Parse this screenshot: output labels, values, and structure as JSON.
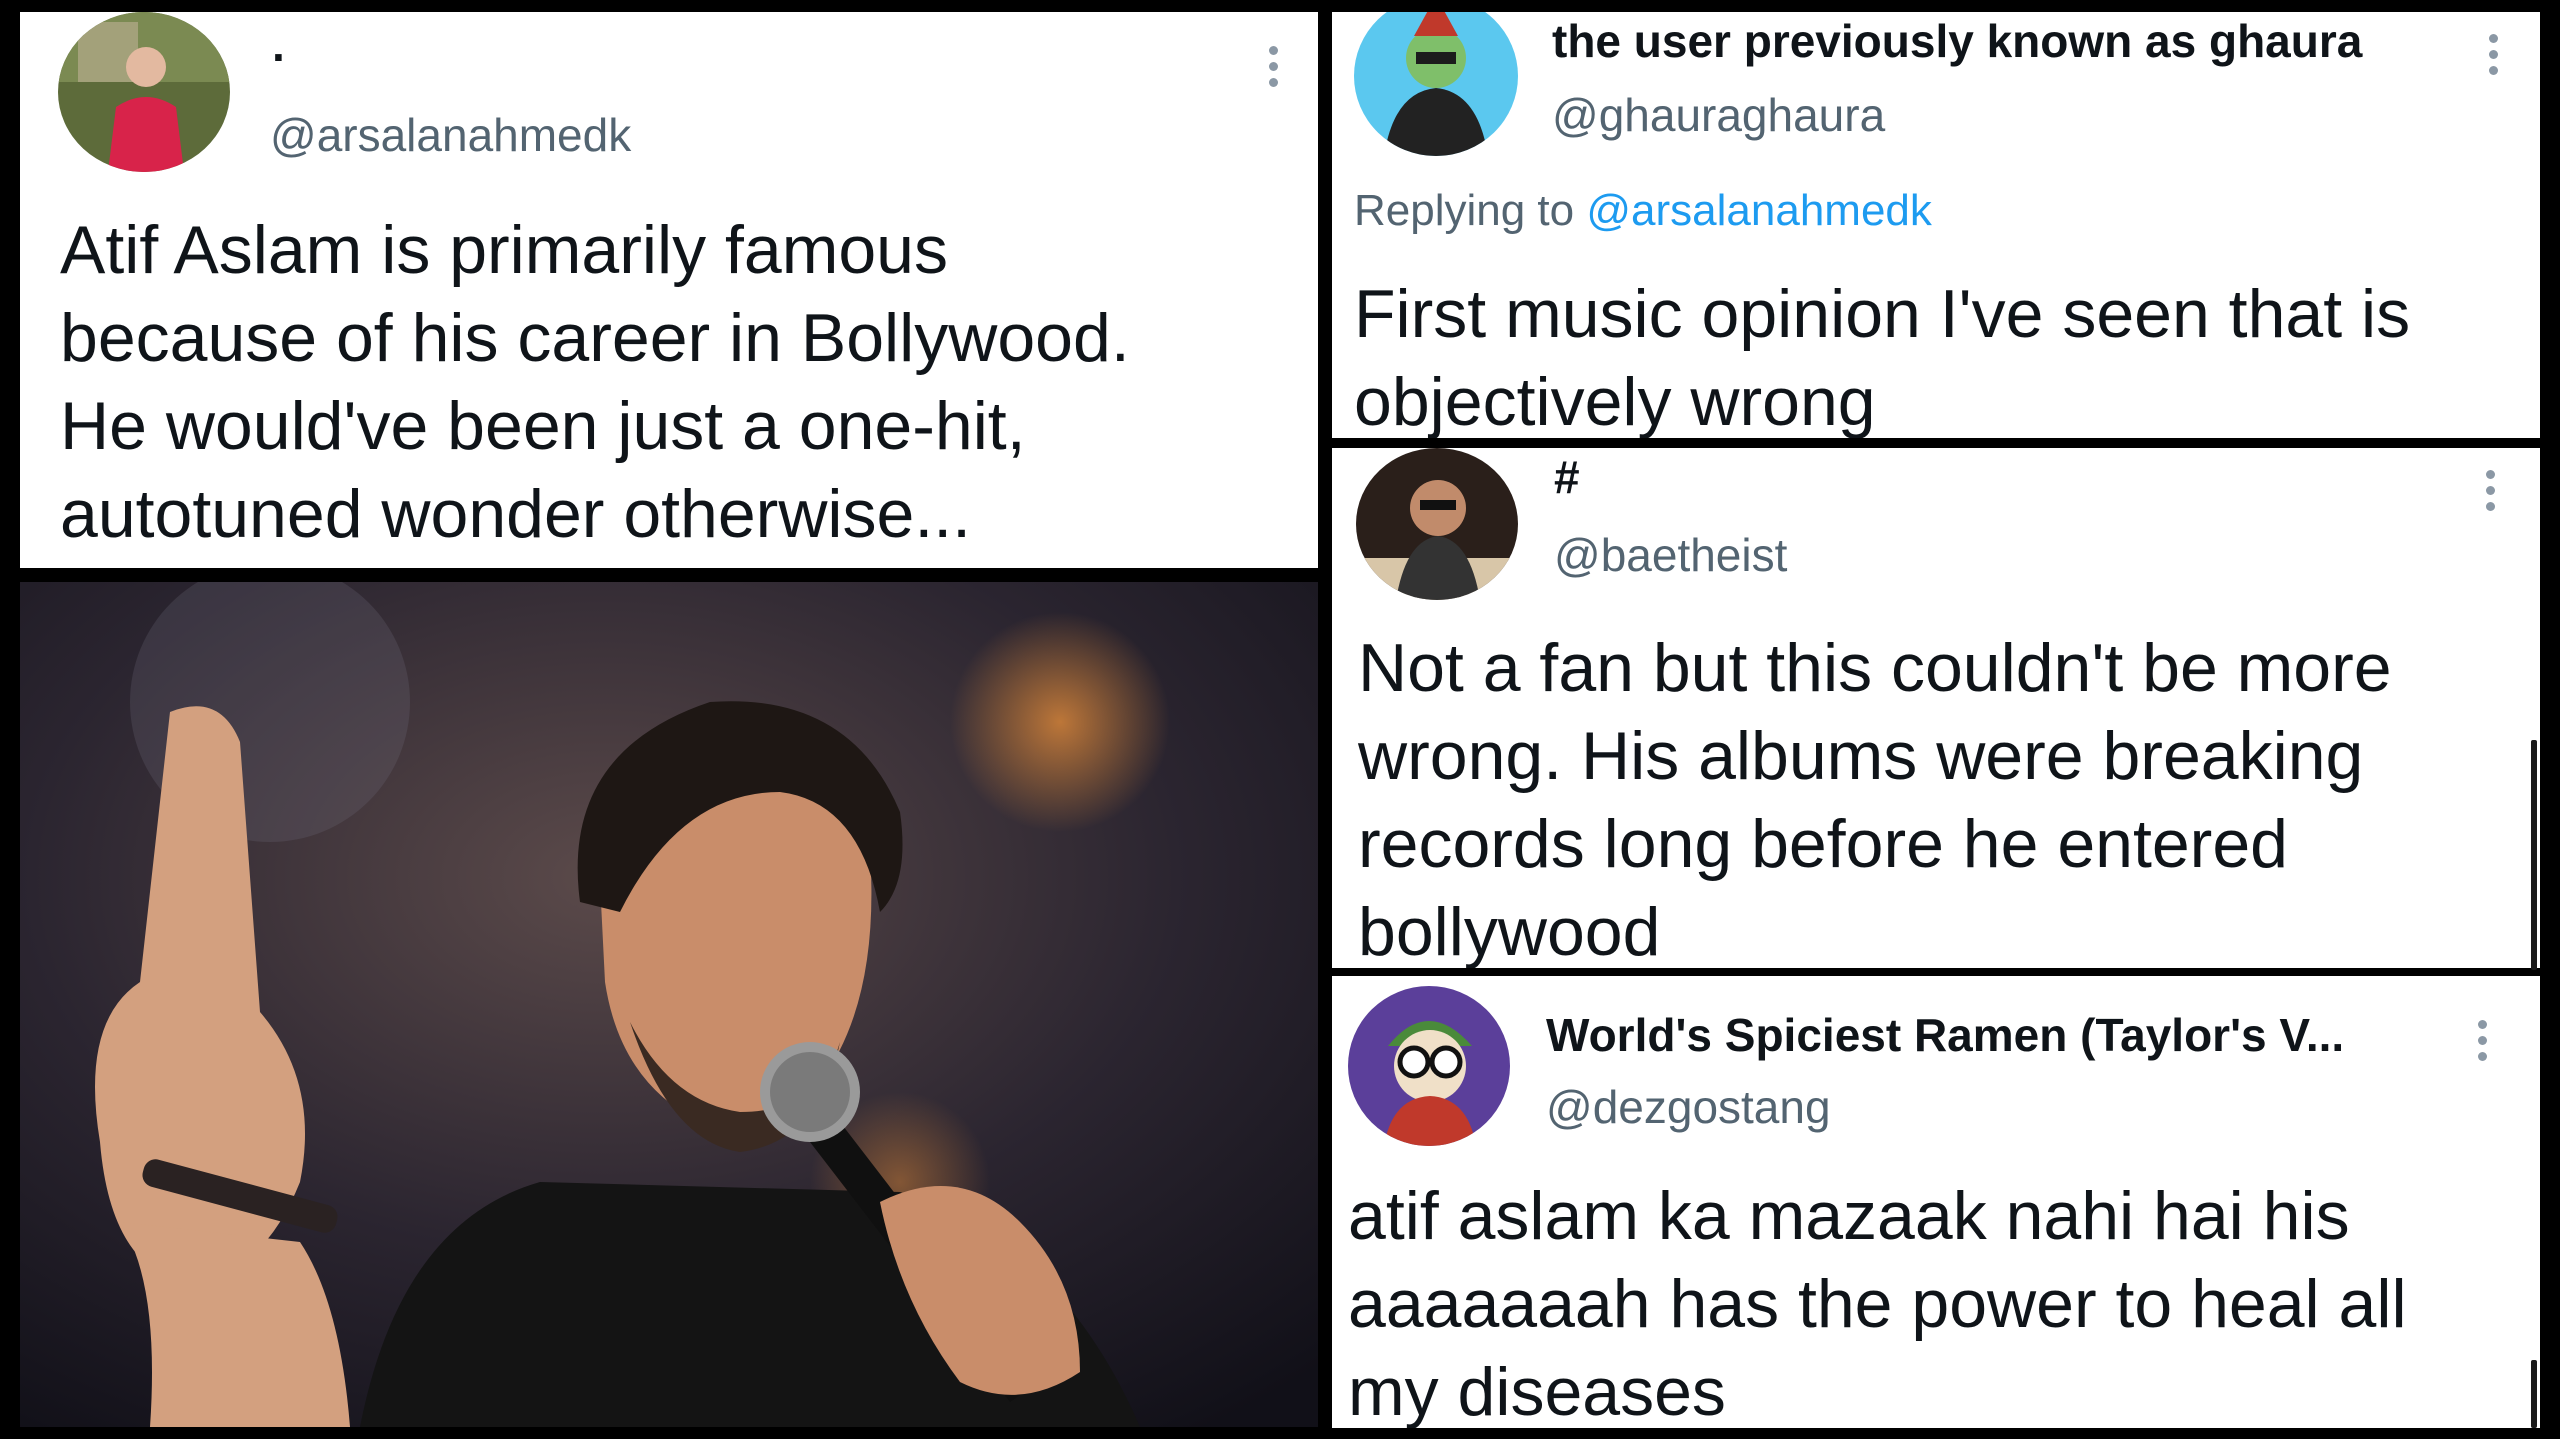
{
  "main_tweet": {
    "display_name": "·",
    "handle": "@arsalanahmedk",
    "text": "Atif Aslam is primarily famous\nbecause of his career in Bollywood.\nHe would've been just a one-hit,\nautotuned wonder otherwise...",
    "avatar_icon": "person-avatar-icon",
    "more_icon": "more-options-icon"
  },
  "reply_1": {
    "display_name": "the user previously known as ghaura",
    "handle": "@ghauraghaura",
    "replying_label": "Replying to",
    "replying_to": "@arsalanahmedk",
    "text": "First music opinion I've seen that is\nobjectively wrong"
  },
  "reply_2": {
    "display_name": "#",
    "handle": "@baetheist",
    "text": "Not a fan but this couldn't be more\nwrong. His albums were breaking\nrecords long before he entered\nbollywood"
  },
  "reply_3": {
    "display_name": "World's Spiciest Ramen (Taylor's V...",
    "handle": "@dezgostang",
    "text": "atif aslam ka mazaak nahi hai his\naaaaaaah has the power to heal all\nmy diseases"
  },
  "colors": {
    "text": "#0f1419",
    "secondary": "#536471",
    "link": "#1d9bf0",
    "border": "#000000"
  }
}
